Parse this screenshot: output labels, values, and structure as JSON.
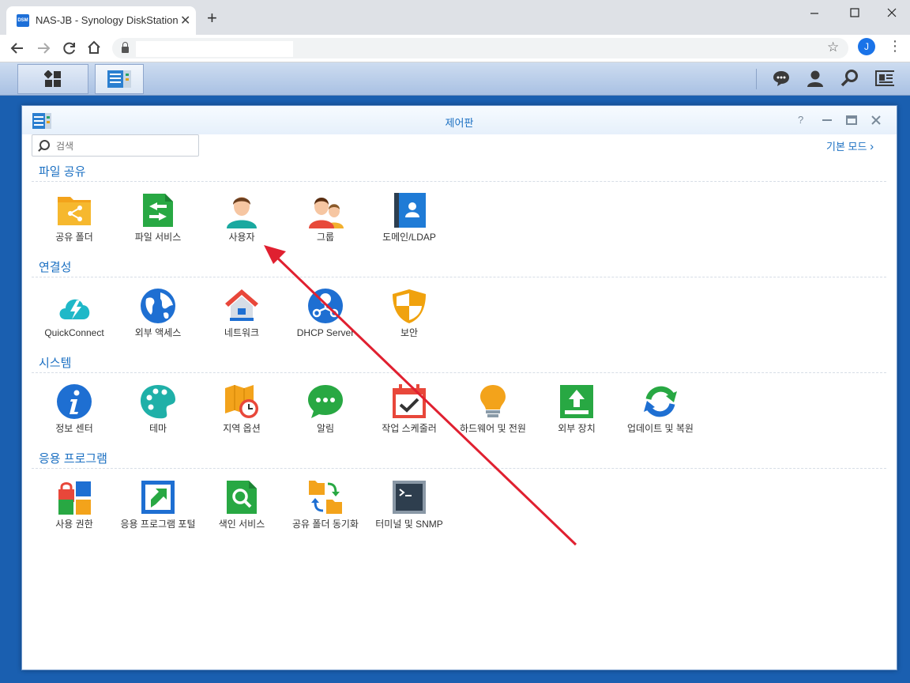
{
  "browser": {
    "tab_title": "NAS-JB - Synology DiskStation",
    "tab_favicon": "DSM",
    "tab_close": "✕",
    "new_tab": "+",
    "url": "",
    "avatar_letter": "J",
    "icons": [
      "back-icon",
      "forward-icon",
      "reload-icon",
      "home-icon",
      "lock-icon",
      "star-icon",
      "kebab-menu-icon",
      "minimize-icon",
      "maximize-icon",
      "close-icon"
    ]
  },
  "window": {
    "title": "제어판",
    "search_placeholder": "검색",
    "basic_mode_label": "기본 모드"
  },
  "sections": [
    {
      "title": "파일 공유",
      "items": [
        {
          "label": "공유 폴더",
          "icon": "shared-folder-icon"
        },
        {
          "label": "파일 서비스",
          "icon": "file-services-icon"
        },
        {
          "label": "사용자",
          "icon": "user-icon"
        },
        {
          "label": "그룹",
          "icon": "group-icon"
        },
        {
          "label": "도메인/LDAP",
          "icon": "domain-ldap-icon"
        }
      ]
    },
    {
      "title": "연결성",
      "items": [
        {
          "label": "QuickConnect",
          "icon": "quickconnect-icon"
        },
        {
          "label": "외부 액세스",
          "icon": "external-access-icon"
        },
        {
          "label": "네트워크",
          "icon": "network-icon"
        },
        {
          "label": "DHCP Server",
          "icon": "dhcp-server-icon"
        },
        {
          "label": "보안",
          "icon": "security-icon"
        }
      ]
    },
    {
      "title": "시스템",
      "items": [
        {
          "label": "정보 센터",
          "icon": "info-center-icon"
        },
        {
          "label": "테마",
          "icon": "theme-icon"
        },
        {
          "label": "지역 옵션",
          "icon": "regional-options-icon"
        },
        {
          "label": "알림",
          "icon": "notification-icon"
        },
        {
          "label": "작업 스케줄러",
          "icon": "task-scheduler-icon"
        },
        {
          "label": "하드웨어 및 전원",
          "icon": "hardware-power-icon"
        },
        {
          "label": "외부 장치",
          "icon": "external-devices-icon"
        },
        {
          "label": "업데이트 및 복원",
          "icon": "update-restore-icon"
        }
      ]
    },
    {
      "title": "응용 프로그램",
      "items": [
        {
          "label": "사용 권한",
          "icon": "privileges-icon"
        },
        {
          "label": "응용 프로그램 포털",
          "icon": "application-portal-icon"
        },
        {
          "label": "색인 서비스",
          "icon": "indexing-service-icon"
        },
        {
          "label": "공유 폴더 동기화",
          "icon": "shared-folder-sync-icon"
        },
        {
          "label": "터미널 및 SNMP",
          "icon": "terminal-snmp-icon"
        }
      ]
    }
  ],
  "colors": {
    "accent": "#1a6fc2",
    "annotation_arrow": "#e02030",
    "desktop": "#1a5fb0"
  }
}
